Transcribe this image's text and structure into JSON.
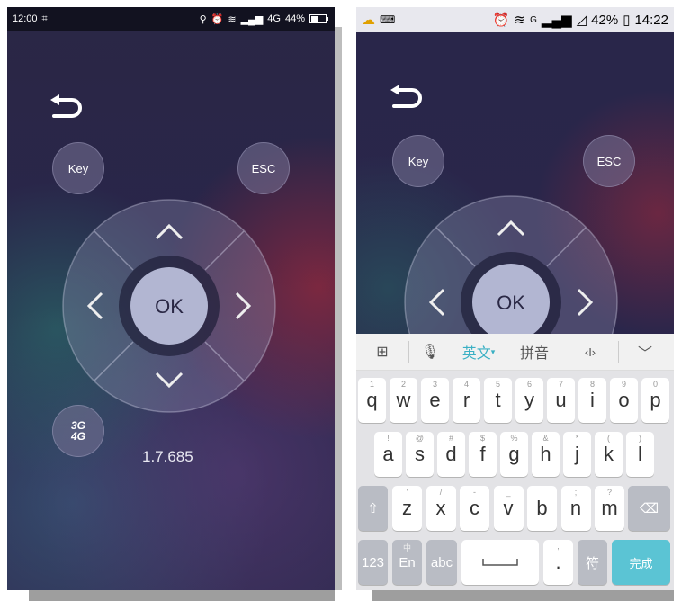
{
  "left_phone": {
    "status": {
      "time": "12:00",
      "network": "4G",
      "battery": "44%"
    },
    "buttons": {
      "key": "Key",
      "esc": "ESC",
      "ok": "OK",
      "network_badge_top": "3G",
      "network_badge_bottom": "4G"
    },
    "version": "1.7.685"
  },
  "right_phone": {
    "status": {
      "signal_tag": "G",
      "battery": "42%",
      "time": "14:22"
    },
    "buttons": {
      "key": "Key",
      "esc": "ESC",
      "ok": "OK"
    },
    "keyboard_toolbar": {
      "english": "英文",
      "pinyin": "拼音",
      "cursor": "‹I›"
    },
    "row1": [
      {
        "main": "q",
        "sub": "1"
      },
      {
        "main": "w",
        "sub": "2"
      },
      {
        "main": "e",
        "sub": "3"
      },
      {
        "main": "r",
        "sub": "4"
      },
      {
        "main": "t",
        "sub": "5"
      },
      {
        "main": "y",
        "sub": "6"
      },
      {
        "main": "u",
        "sub": "7"
      },
      {
        "main": "i",
        "sub": "8"
      },
      {
        "main": "o",
        "sub": "9"
      },
      {
        "main": "p",
        "sub": "0"
      }
    ],
    "row2": [
      {
        "main": "a",
        "sub": "!"
      },
      {
        "main": "s",
        "sub": "@"
      },
      {
        "main": "d",
        "sub": "#"
      },
      {
        "main": "f",
        "sub": "$"
      },
      {
        "main": "g",
        "sub": "%"
      },
      {
        "main": "h",
        "sub": "&"
      },
      {
        "main": "j",
        "sub": "*"
      },
      {
        "main": "k",
        "sub": "("
      },
      {
        "main": "l",
        "sub": ")"
      }
    ],
    "row3": [
      {
        "main": "z",
        "sub": "'"
      },
      {
        "main": "x",
        "sub": "/"
      },
      {
        "main": "c",
        "sub": "-"
      },
      {
        "main": "v",
        "sub": "_"
      },
      {
        "main": "b",
        "sub": ":"
      },
      {
        "main": "n",
        "sub": ";"
      },
      {
        "main": "m",
        "sub": "?"
      }
    ],
    "row4": {
      "num": "123",
      "en_top": "中",
      "en": "En",
      "abc": "abc",
      "comma": ",",
      "period": ".",
      "symbol": "符",
      "done": "完成"
    }
  }
}
